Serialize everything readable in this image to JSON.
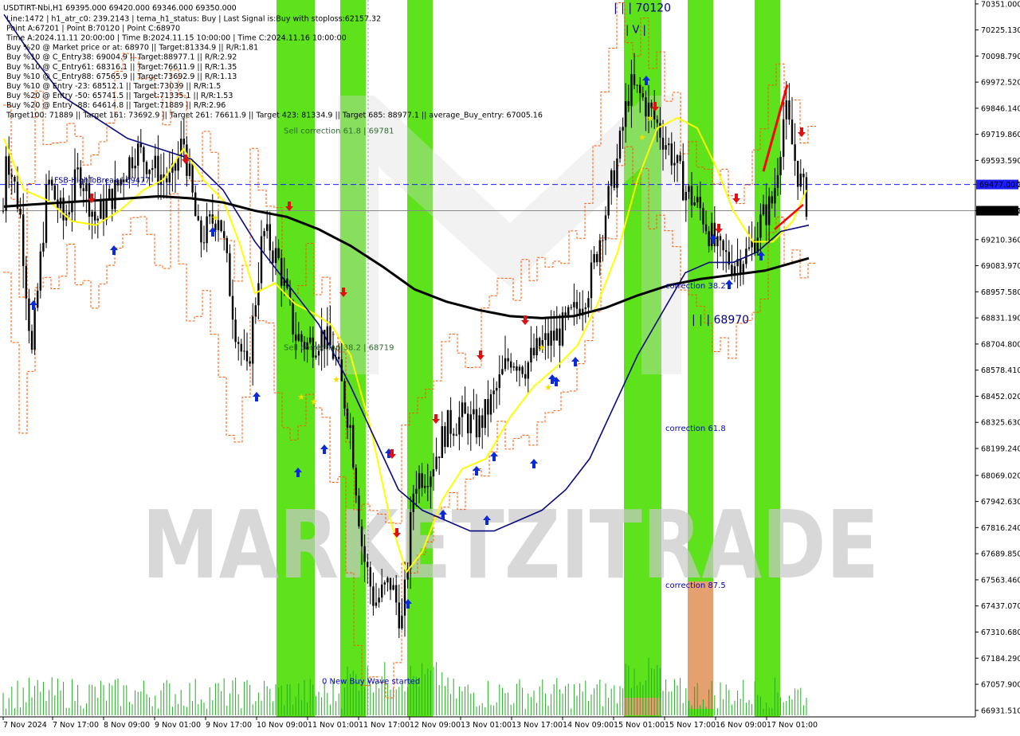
{
  "chart_data": {
    "type": "candlestick",
    "symbol_line": "USDTIRT-Nbi,H1  69395.000 69420.000 69346.000 69350.000",
    "info_lines": [
      "Line:1472 | h1_atr_c0: 239.2143 | tema_h1_status: Buy | Last Signal is:Buy with stoploss:62157.32",
      "Point A:67201 | Point B:70120 | Point C:68970",
      "Time A:2024.11.11 20:00:00 | Time B:2024.11.15 10:00:00 | Time C:2024.11.16 10:00:00",
      "Buy %20 @ Market price or at: 68970 || Target:81334.9 || R/R:1.81",
      "Buy %10 @ C_Entry38: 69004.9 || Target:88977.1 || R/R:2.92",
      "Buy %10 @ C_Entry61: 68316.1 || Target:76611.9 || R/R:1.35",
      "Buy %10 @ C_Entry88: 67565.9 || Target:73692.9 || R/R:1.13",
      "Buy %10 @ Entry -23: 68512.1 || Target:73039 || R/R:1.5",
      "Buy %20 @ Entry -50: 65741.5 || Target:71335.1 || R/R:1.53",
      "Buy %20 @ Entry -88: 64614.8 || Target:71889 || R/R:2.96",
      "Target100: 71889 || Target 161: 73692.9 || Target 261: 76611.9 || Target 423: 81334.9 || Target 685: 88977.1 || average_Buy_entry: 67005.16"
    ],
    "y_ticks": [
      "70351.000",
      "70225.130",
      "70098.790",
      "69972.520",
      "69846.140",
      "69719.860",
      "69593.590",
      "69477.000",
      "69350.000",
      "69210.360",
      "69083.970",
      "68957.580",
      "68831.190",
      "68704.800",
      "68578.410",
      "68452.020",
      "68325.630",
      "68199.240",
      "68069.020",
      "67942.630",
      "67816.240",
      "67689.850",
      "67563.460",
      "67437.070",
      "67310.680",
      "67184.290",
      "67057.900",
      "66931.510"
    ],
    "y_tick_values": [
      70351,
      70225.13,
      70098.79,
      69972.52,
      69846.14,
      69719.86,
      69593.59,
      69477,
      69350,
      69210.36,
      69083.97,
      68957.58,
      68831.19,
      68704.8,
      68578.41,
      68452.02,
      68325.63,
      68199.24,
      68069.02,
      67942.63,
      67816.24,
      67689.85,
      67563.46,
      67437.07,
      67310.68,
      67184.29,
      67057.9,
      66931.51
    ],
    "ylim": [
      66900,
      70370
    ],
    "x_ticks": [
      "7 Nov 2024",
      "7 Nov 17:00",
      "8 Nov 09:00",
      "9 Nov 01:00",
      "9 Nov 17:00",
      "10 Nov 09:00",
      "11 Nov 01:00",
      "11 Nov 17:00",
      "12 Nov 09:00",
      "13 Nov 01:00",
      "13 Nov 17:00",
      "14 Nov 09:00",
      "15 Nov 01:00",
      "15 Nov 17:00",
      "16 Nov 09:00",
      "17 Nov 01:00"
    ],
    "price_labels": {
      "blue_line": "69477.000",
      "current": "69350.000"
    },
    "blue_line_value": 69477,
    "current_value": 69350,
    "annotations": [
      {
        "text": "| | | 70120",
        "color": "#000080",
        "y_value": 70330
      },
      {
        "text": "| V |",
        "color": "#000080",
        "y_value": 70225
      },
      {
        "text": "| | | 68970",
        "color": "#000080",
        "y_value": 68820
      },
      {
        "text": "Sell correction 61.8 | 69781",
        "color": "#2e6b2e",
        "y_value": 69740
      },
      {
        "text": "Sell correction 38.2 | 68719",
        "color": "#2e6b2e",
        "y_value": 68690
      },
      {
        "text": "FSB-HighToBreak | 69477",
        "color": "#000080",
        "y_value": 69500
      },
      {
        "text": "correction 38.2",
        "color": "#0000cd",
        "y_value": 68990
      },
      {
        "text": "correction 61.8",
        "color": "#0000cd",
        "y_value": 68300
      },
      {
        "text": "correction 87.5",
        "color": "#0000cd",
        "y_value": 67540
      },
      {
        "text": "0 New Buy Wave started",
        "color": "#0000cd",
        "y_value": 67075
      }
    ],
    "watermark": "MARKETZITRADE",
    "series": [
      {
        "name": "",
        "color": "#ffff00"
      },
      {
        "name": "",
        "color": "#00008b"
      },
      {
        "name": "",
        "color": "#000000"
      }
    ],
    "grid": false
  }
}
